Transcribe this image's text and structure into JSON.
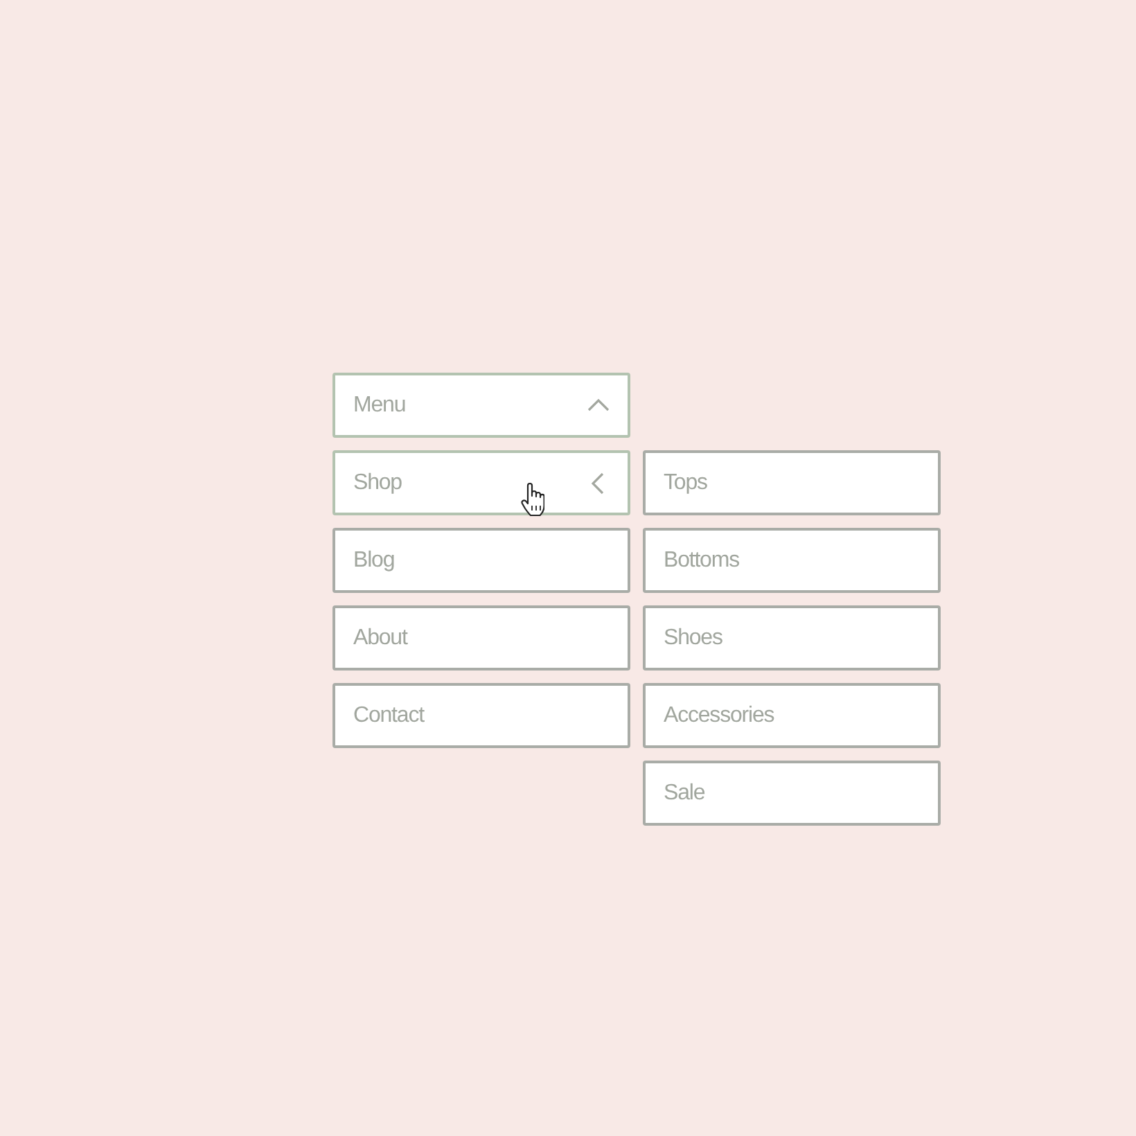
{
  "menu": {
    "label": "Menu",
    "expanded": true,
    "items": [
      {
        "label": "Shop",
        "expanded": true,
        "children": [
          {
            "label": "Tops"
          },
          {
            "label": "Bottoms"
          },
          {
            "label": "Shoes"
          },
          {
            "label": "Accessories"
          },
          {
            "label": "Sale"
          }
        ]
      },
      {
        "label": "Blog",
        "expanded": false
      },
      {
        "label": "About",
        "expanded": false
      },
      {
        "label": "Contact",
        "expanded": false
      }
    ]
  }
}
